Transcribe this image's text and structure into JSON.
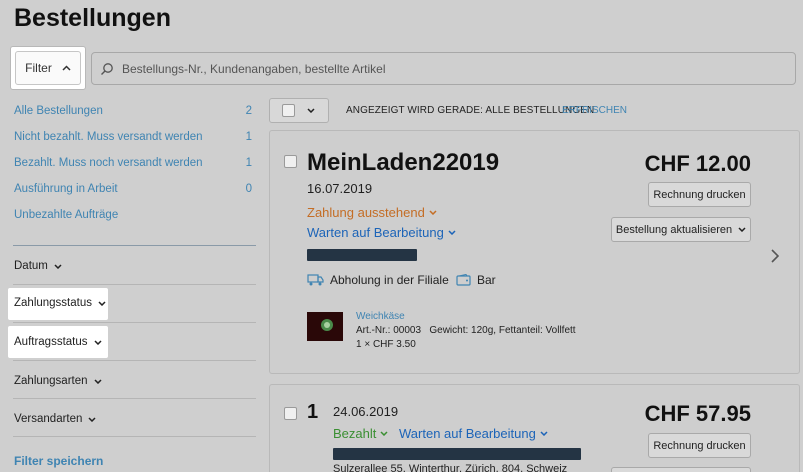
{
  "page": {
    "title": "Bestellungen"
  },
  "filter": {
    "label": "Filter"
  },
  "search": {
    "placeholder": "Bestellungs-Nr., Kundenangaben, bestellte Artikel"
  },
  "sidebar": {
    "items": [
      {
        "label": "Alle Bestellungen",
        "count": "2"
      },
      {
        "label": "Nicht bezahlt. Muss versandt werden",
        "count": "1"
      },
      {
        "label": "Bezahlt. Muss noch versandt werden",
        "count": "1"
      },
      {
        "label": "Ausführung in Arbeit",
        "count": "0"
      },
      {
        "label": "Unbezahlte Aufträge",
        "count": ""
      }
    ],
    "facets": [
      {
        "label": "Datum"
      },
      {
        "label": "Zahlungsstatus"
      },
      {
        "label": "Auftragsstatus"
      },
      {
        "label": "Zahlungsarten"
      },
      {
        "label": "Versandarten"
      }
    ],
    "save_filter": "Filter speichern"
  },
  "list_header": {
    "showing": "ANGEZEIGT WIRD GERADE: ALLE BESTELLUNGEN",
    "refresh": "ERFRISCHEN"
  },
  "orders": [
    {
      "name": "MeinLaden22019",
      "date": "16.07.2019",
      "payment_status": "Zahlung ausstehend",
      "fulfillment_status": "Warten auf Bearbeitung",
      "amount": "CHF 12.00",
      "print_label": "Rechnung drucken",
      "update_label": "Bestellung aktualisieren",
      "delivery": "Abholung in der Filiale",
      "payment_method": "Bar",
      "product": {
        "name": "Weichkäse",
        "details": "Art.-Nr.: 00003   Gewicht: 120g, Fettanteil: Vollfett",
        "qty_price": "1 × CHF 3.50"
      }
    },
    {
      "name": "1",
      "date": "24.06.2019",
      "payment_status": "Bezahlt",
      "fulfillment_status": "Warten auf Bearbeitung",
      "amount": "CHF 57.95",
      "print_label": "Rechnung drucken",
      "address_partial": "Sulzerallee 55, Winterthur, Zürich, 804, Schweiz"
    }
  ],
  "colors": {
    "link": "#3f84b2",
    "pending": "#c46d25",
    "processing": "#1c64b8",
    "paid": "#3a8f32"
  }
}
